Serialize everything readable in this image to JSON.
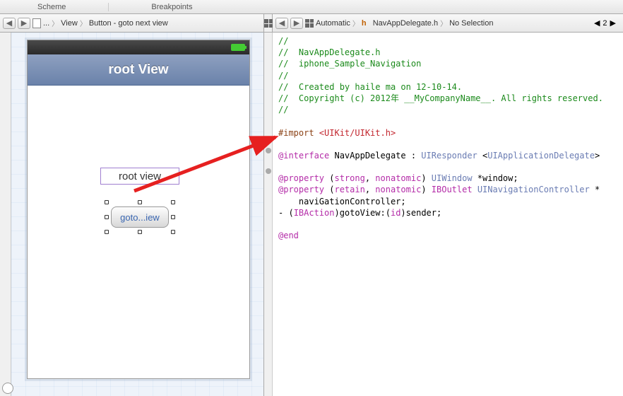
{
  "tabs": {
    "scheme": "Scheme",
    "breakpoints": "Breakpoints"
  },
  "left_bc": {
    "a": "...",
    "b": "View",
    "c": "Button - goto  next view"
  },
  "right_bc": {
    "mode": "Automatic",
    "file": "NavAppDelegate.h",
    "sel": "No Selection",
    "page": "2"
  },
  "phone": {
    "nav_title": "root View",
    "label_text": "root view",
    "button_text": "goto...iew"
  },
  "code": {
    "l1": "//",
    "l2": "//  NavAppDelegate.h",
    "l3": "//  iphone_Sample_Navigation",
    "l4": "//",
    "l5": "//  Created by haile ma on 12-10-14.",
    "l6": "//  Copyright (c) 2012年 __MyCompanyName__. All rights reserved.",
    "l7": "//",
    "imp_a": "#import",
    "imp_b": " <UIKit/UIKit.h>",
    "if_a": "@interface",
    "if_b": " NavAppDelegate : ",
    "if_c": "UIResponder",
    "if_d": " <",
    "if_e": "UIApplicationDelegate",
    "if_f": ">",
    "p1a": "@property",
    "p1b": " (",
    "p1c": "strong",
    "p1d": ", ",
    "p1e": "nonatomic",
    "p1f": ") ",
    "p1g": "UIWindow",
    "p1h": " *window;",
    "p2a": "@property",
    "p2b": " (",
    "p2c": "retain",
    "p2d": ", ",
    "p2e": "nonatomic",
    "p2f": ") ",
    "p2g": "IBOutlet",
    "p2h": " ",
    "p2i": "UINavigationController",
    "p2j": " *",
    "p2k": "    naviGationController;",
    "iba": "- (",
    "ibb": "IBAction",
    "ibc": ")gotoView:(",
    "ibd": "id",
    "ibe": ")sender;",
    "end": "@end"
  }
}
